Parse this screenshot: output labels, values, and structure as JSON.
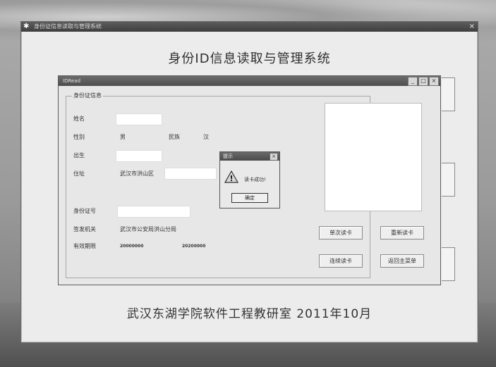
{
  "main": {
    "window_title": "身份证信息读取与管理系统",
    "app_icon": "app-icon",
    "close_glyph": "×",
    "heading": "身份ID信息读取与管理系统",
    "footer": "武汉东湖学院软件工程教研室   2011年10月"
  },
  "dialog": {
    "title": "IDRead",
    "controls": [
      "_",
      "□",
      "×"
    ],
    "group_label": "身份证信息",
    "labels": {
      "name": "姓名",
      "gender": "性别",
      "ethnicity": "民族",
      "birth": "出生",
      "address": "住址",
      "id_number": "身份证号",
      "issuer": "签发机关",
      "validity": "有效期限"
    },
    "values": {
      "name": "",
      "gender": "男",
      "ethnicity": "汉",
      "birth": "",
      "address": "武汉市洪山区",
      "id_number": "",
      "issuer": "武汉市公安局洪山分局",
      "valid_from": "20000000",
      "valid_to": "20200000"
    },
    "buttons": {
      "single_read": "单次读卡",
      "reread": "重新读卡",
      "continuous_read": "连续读卡",
      "back_menu": "返回主菜单"
    }
  },
  "alert": {
    "title": "提示",
    "close_glyph": "×",
    "icon": "warning-icon",
    "message": "读卡成功!",
    "ok_label": "确定"
  }
}
